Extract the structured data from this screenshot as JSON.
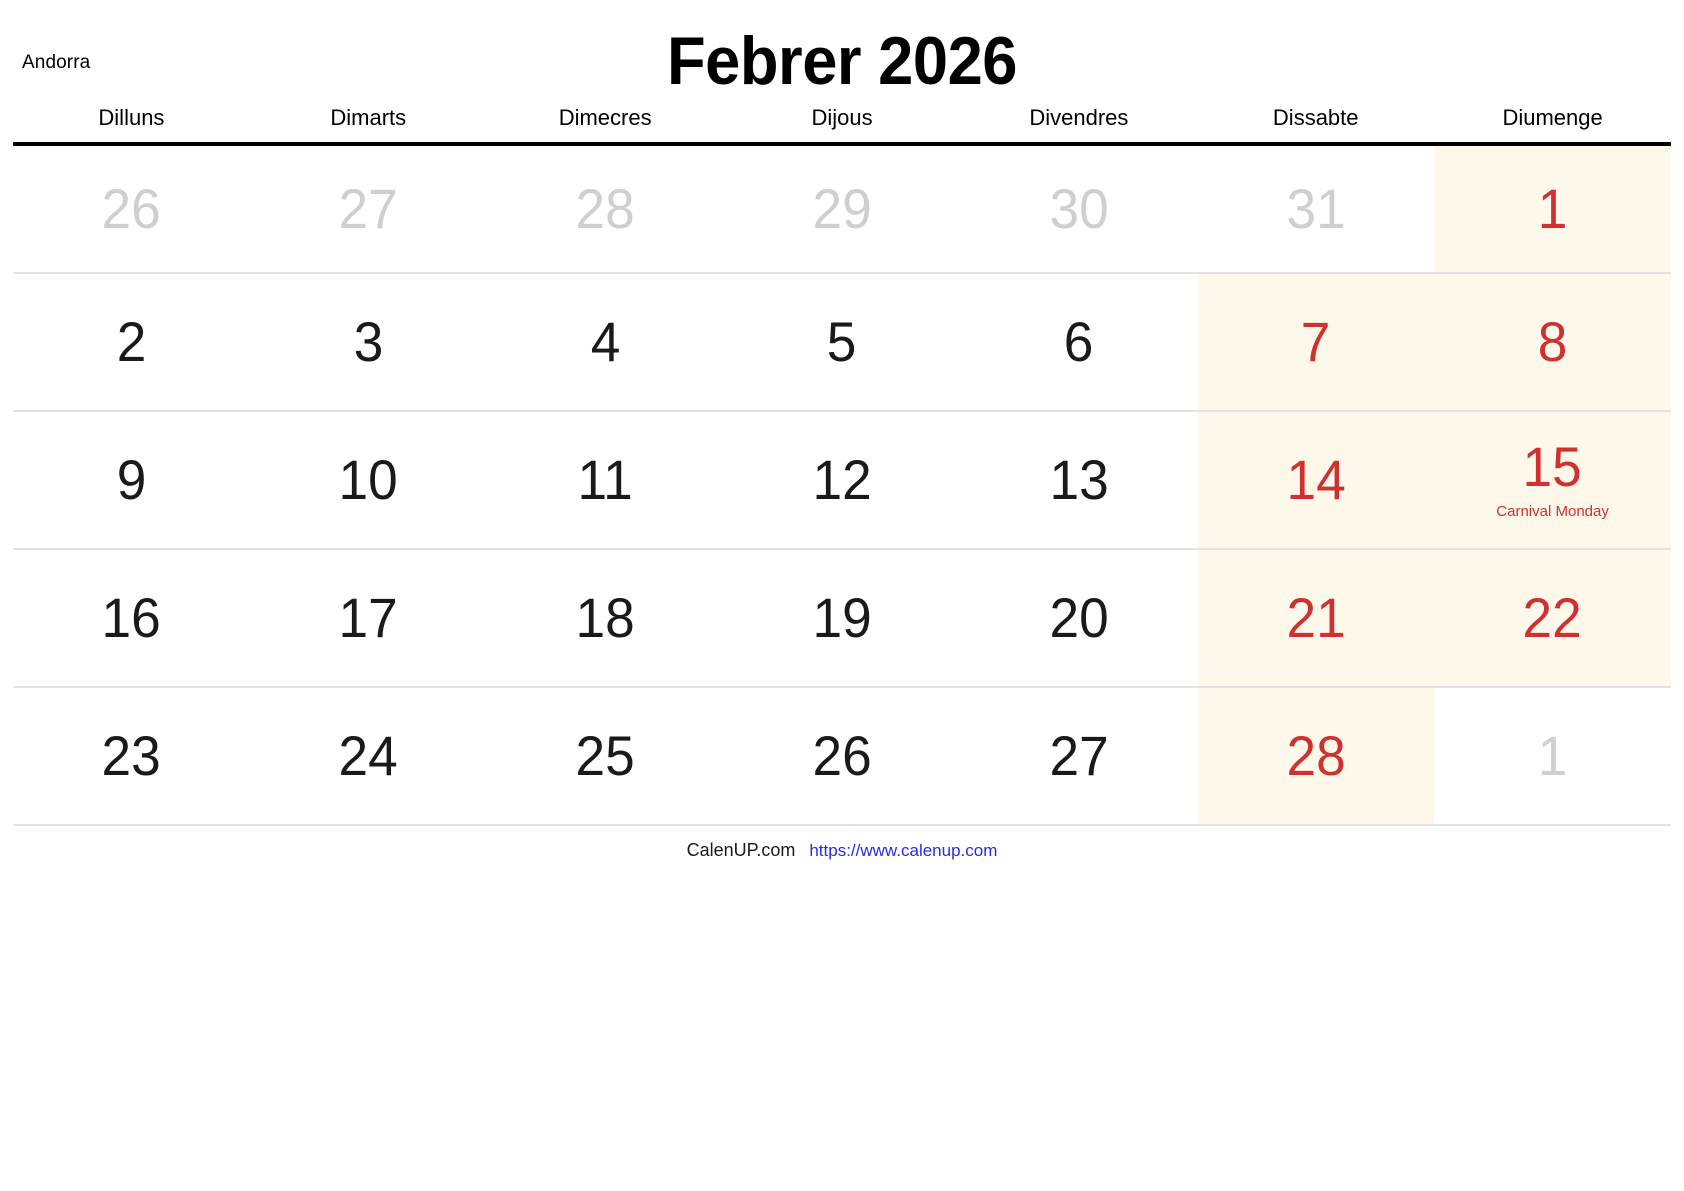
{
  "header": {
    "country": "Andorra",
    "title": "Febrer 2026"
  },
  "weekdays": [
    {
      "label": "Dilluns"
    },
    {
      "label": "Dimarts"
    },
    {
      "label": "Dimecres"
    },
    {
      "label": "Dijous"
    },
    {
      "label": "Divendres"
    },
    {
      "label": "Dissabte"
    },
    {
      "label": "Diumenge"
    }
  ],
  "weeks": [
    {
      "days": [
        {
          "num": "26",
          "type": "other",
          "weekend": false,
          "event": ""
        },
        {
          "num": "27",
          "type": "other",
          "weekend": false,
          "event": ""
        },
        {
          "num": "28",
          "type": "other",
          "weekend": false,
          "event": ""
        },
        {
          "num": "29",
          "type": "other",
          "weekend": false,
          "event": ""
        },
        {
          "num": "30",
          "type": "other",
          "weekend": false,
          "event": ""
        },
        {
          "num": "31",
          "type": "other",
          "weekend": false,
          "event": ""
        },
        {
          "num": "1",
          "type": "sunday",
          "weekend": true,
          "event": ""
        }
      ]
    },
    {
      "days": [
        {
          "num": "2",
          "type": "normal",
          "weekend": false,
          "event": ""
        },
        {
          "num": "3",
          "type": "normal",
          "weekend": false,
          "event": ""
        },
        {
          "num": "4",
          "type": "normal",
          "weekend": false,
          "event": ""
        },
        {
          "num": "5",
          "type": "normal",
          "weekend": false,
          "event": ""
        },
        {
          "num": "6",
          "type": "normal",
          "weekend": false,
          "event": ""
        },
        {
          "num": "7",
          "type": "saturday",
          "weekend": true,
          "event": ""
        },
        {
          "num": "8",
          "type": "sunday",
          "weekend": true,
          "event": ""
        }
      ]
    },
    {
      "days": [
        {
          "num": "9",
          "type": "normal",
          "weekend": false,
          "event": ""
        },
        {
          "num": "10",
          "type": "normal",
          "weekend": false,
          "event": ""
        },
        {
          "num": "11",
          "type": "normal",
          "weekend": false,
          "event": ""
        },
        {
          "num": "12",
          "type": "normal",
          "weekend": false,
          "event": ""
        },
        {
          "num": "13",
          "type": "normal",
          "weekend": false,
          "event": ""
        },
        {
          "num": "14",
          "type": "saturday",
          "weekend": true,
          "event": ""
        },
        {
          "num": "15",
          "type": "holiday",
          "weekend": true,
          "event": "Carnival Monday"
        }
      ]
    },
    {
      "days": [
        {
          "num": "16",
          "type": "normal",
          "weekend": false,
          "event": ""
        },
        {
          "num": "17",
          "type": "normal",
          "weekend": false,
          "event": ""
        },
        {
          "num": "18",
          "type": "normal",
          "weekend": false,
          "event": ""
        },
        {
          "num": "19",
          "type": "normal",
          "weekend": false,
          "event": ""
        },
        {
          "num": "20",
          "type": "normal",
          "weekend": false,
          "event": ""
        },
        {
          "num": "21",
          "type": "saturday",
          "weekend": true,
          "event": ""
        },
        {
          "num": "22",
          "type": "sunday",
          "weekend": true,
          "event": ""
        }
      ]
    },
    {
      "days": [
        {
          "num": "23",
          "type": "normal",
          "weekend": false,
          "event": ""
        },
        {
          "num": "24",
          "type": "normal",
          "weekend": false,
          "event": ""
        },
        {
          "num": "25",
          "type": "normal",
          "weekend": false,
          "event": ""
        },
        {
          "num": "26",
          "type": "normal",
          "weekend": false,
          "event": ""
        },
        {
          "num": "27",
          "type": "normal",
          "weekend": false,
          "event": ""
        },
        {
          "num": "28",
          "type": "saturday",
          "weekend": true,
          "event": ""
        },
        {
          "num": "1",
          "type": "other",
          "weekend": false,
          "event": ""
        }
      ]
    }
  ],
  "footer": {
    "brand": "CalenUP.com",
    "url": "https://www.calenup.com"
  },
  "colors": {
    "weekend_background": "#fdf8ea",
    "holiday_text": "#cf3030",
    "other_month_text": "#cfcfcf",
    "link": "#2a2ae0",
    "rule": "#000000",
    "row_divider": "#e3e3e3"
  }
}
